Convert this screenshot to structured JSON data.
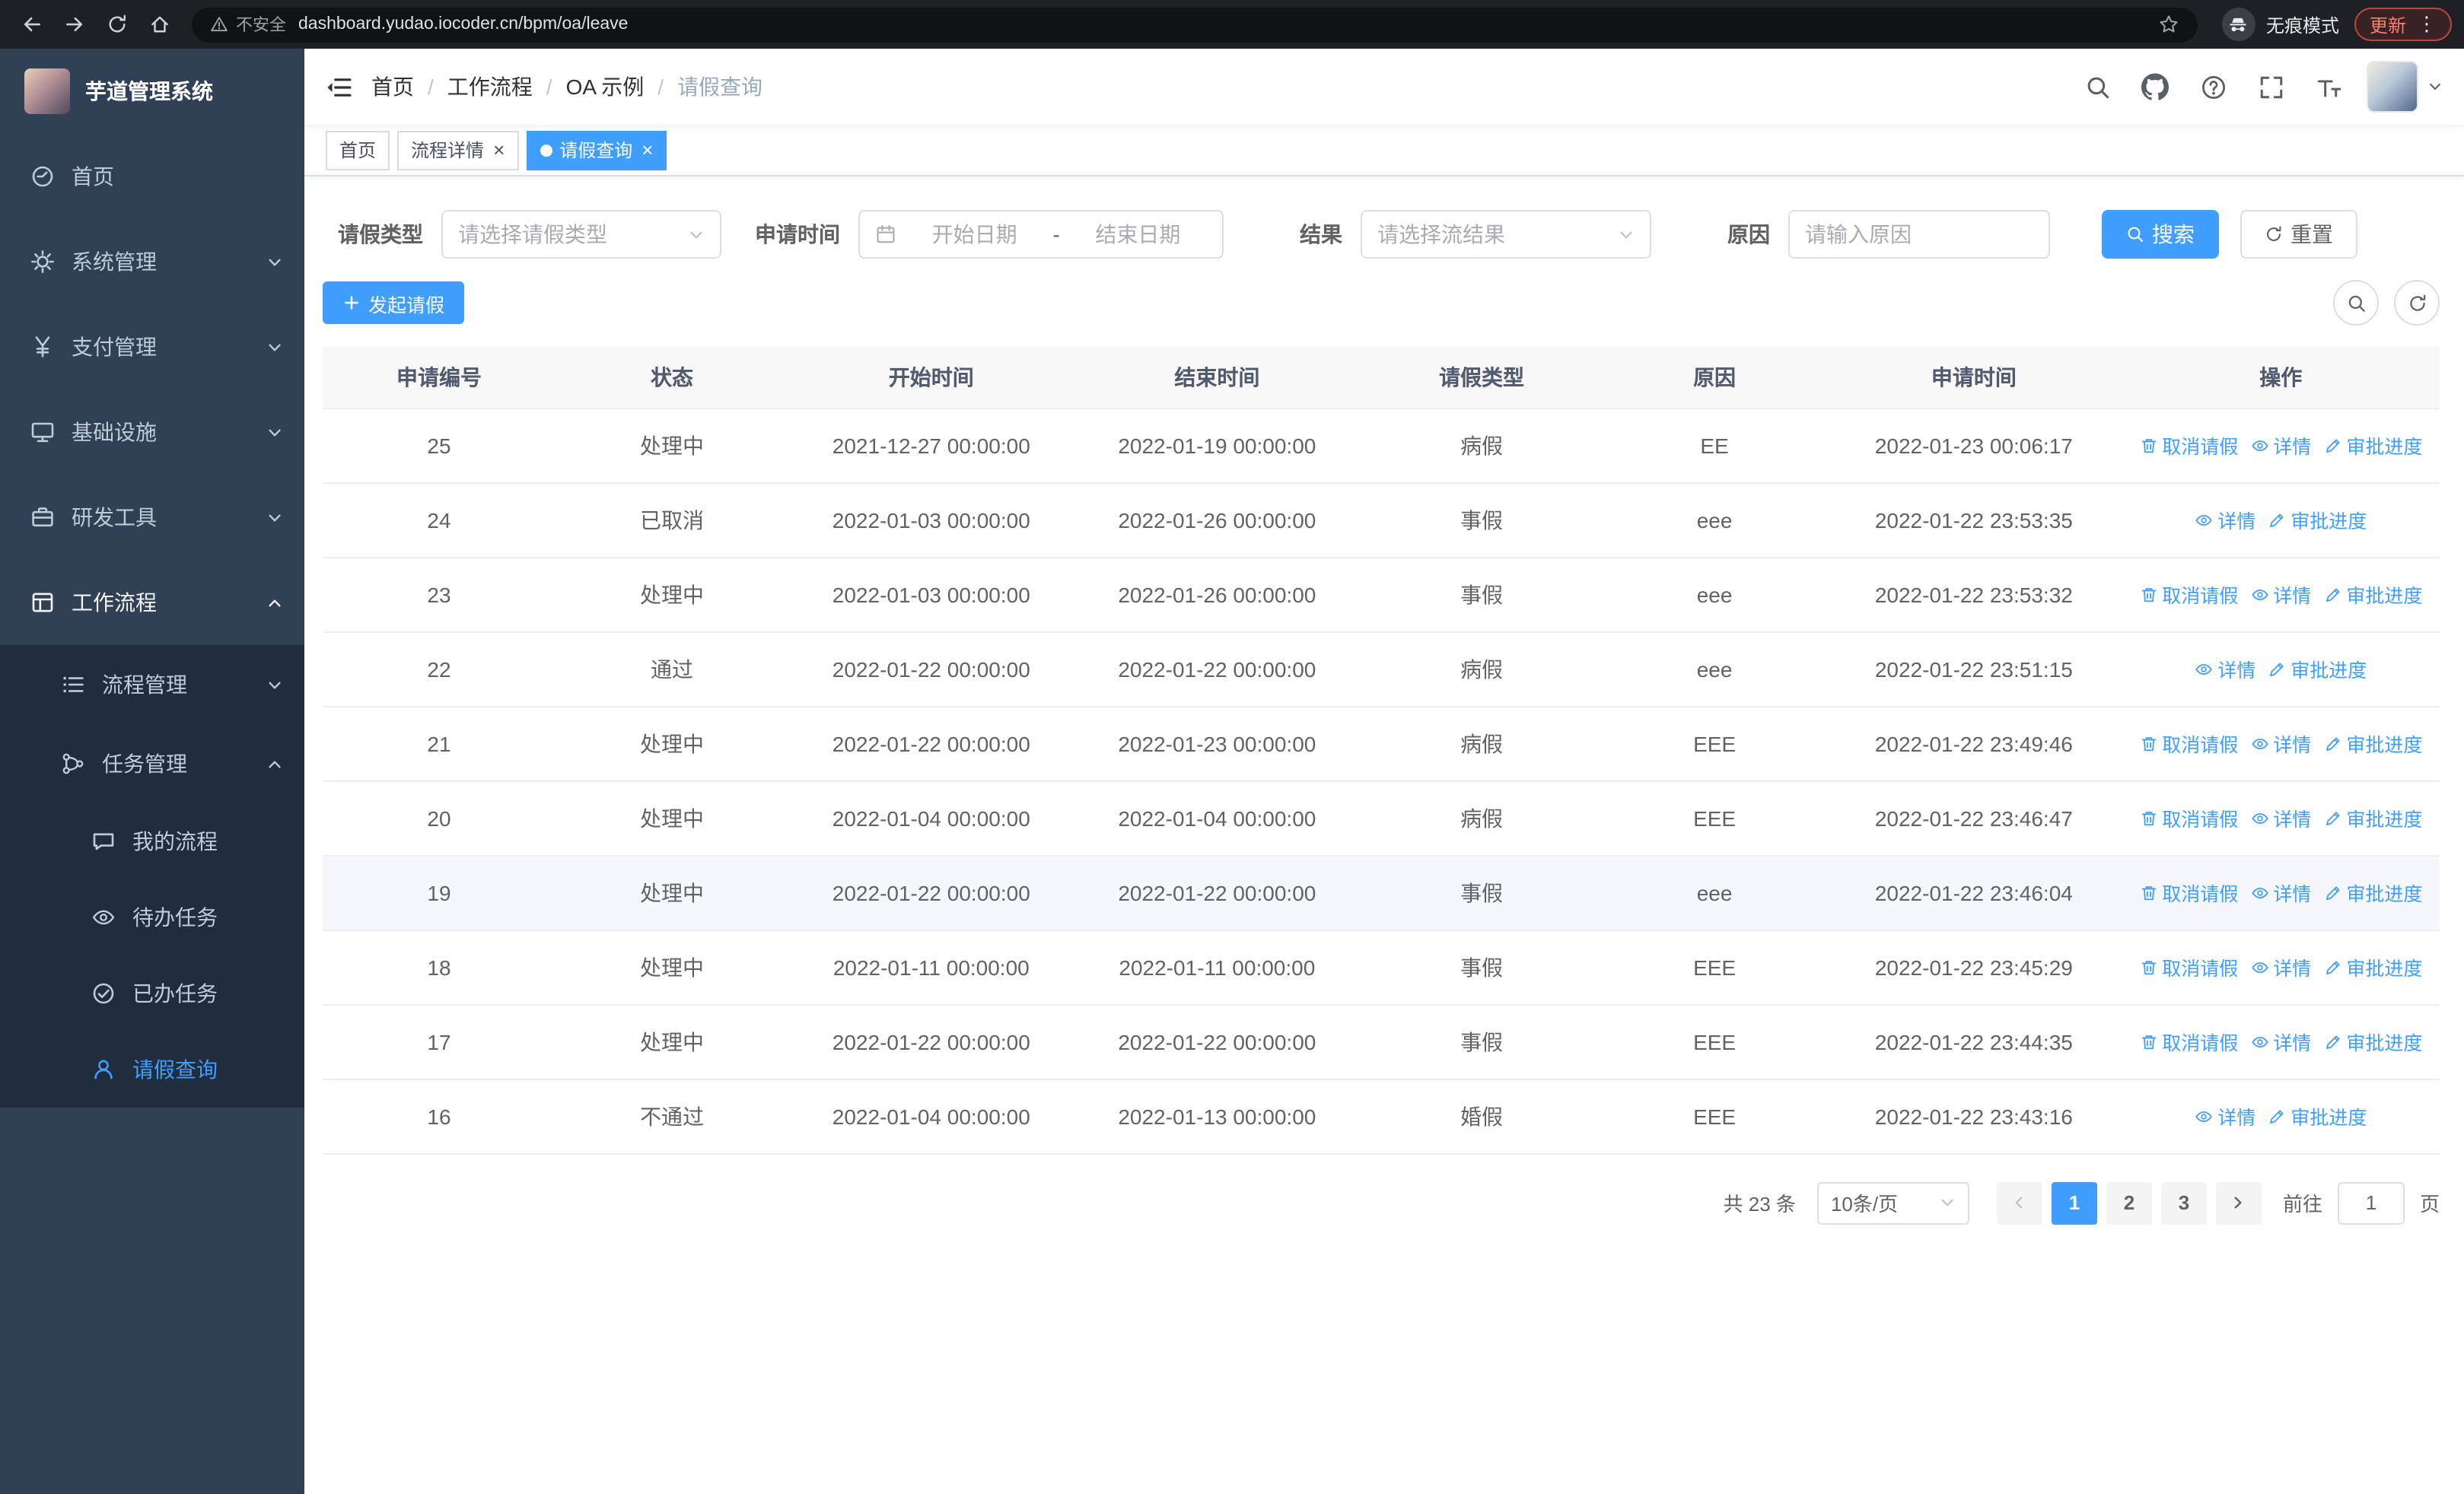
{
  "browser": {
    "warning": "不安全",
    "url": "dashboard.yudao.iocoder.cn/bpm/oa/leave",
    "incognito": "无痕模式",
    "update": "更新"
  },
  "icons": {
    "close": "×",
    "kebab": "⋮"
  },
  "sidebar": {
    "title": "芋道管理系统",
    "menu": [
      {
        "label": "首页"
      },
      {
        "label": "系统管理"
      },
      {
        "label": "支付管理"
      },
      {
        "label": "基础设施"
      },
      {
        "label": "研发工具"
      },
      {
        "label": "工作流程"
      }
    ],
    "submenu": [
      {
        "label": "流程管理"
      },
      {
        "label": "任务管理"
      }
    ],
    "leaves": [
      {
        "label": "我的流程"
      },
      {
        "label": "待办任务"
      },
      {
        "label": "已办任务"
      },
      {
        "label": "请假查询"
      }
    ]
  },
  "breadcrumb": {
    "separator": "/",
    "items": [
      "首页",
      "工作流程",
      "OA 示例",
      "请假查询"
    ]
  },
  "tabs": [
    {
      "label": "首页"
    },
    {
      "label": "流程详情"
    },
    {
      "label": "请假查询"
    }
  ],
  "filters": {
    "leave_type_label": "请假类型",
    "leave_type_placeholder": "请选择请假类型",
    "apply_time_label": "申请时间",
    "start_date_placeholder": "开始日期",
    "range_separator": "-",
    "end_date_placeholder": "结束日期",
    "result_label": "结果",
    "result_placeholder": "请选择流结果",
    "reason_label": "原因",
    "reason_placeholder": "请输入原因",
    "search": "搜索",
    "reset": "重置"
  },
  "toolbar": {
    "create": "发起请假"
  },
  "table": {
    "headers": [
      "申请编号",
      "状态",
      "开始时间",
      "结束时间",
      "请假类型",
      "原因",
      "申请时间",
      "操作"
    ],
    "actions": {
      "cancel": "取消请假",
      "detail": "详情",
      "progress": "审批进度"
    },
    "rows": [
      {
        "id": "25",
        "status": "处理中",
        "start": "2021-12-27 00:00:00",
        "end": "2022-01-19 00:00:00",
        "type": "病假",
        "reason": "EE",
        "applied": "2022-01-23 00:06:17"
      },
      {
        "id": "24",
        "status": "已取消",
        "start": "2022-01-03 00:00:00",
        "end": "2022-01-26 00:00:00",
        "type": "事假",
        "reason": "eee",
        "applied": "2022-01-22 23:53:35"
      },
      {
        "id": "23",
        "status": "处理中",
        "start": "2022-01-03 00:00:00",
        "end": "2022-01-26 00:00:00",
        "type": "事假",
        "reason": "eee",
        "applied": "2022-01-22 23:53:32"
      },
      {
        "id": "22",
        "status": "通过",
        "start": "2022-01-22 00:00:00",
        "end": "2022-01-22 00:00:00",
        "type": "病假",
        "reason": "eee",
        "applied": "2022-01-22 23:51:15"
      },
      {
        "id": "21",
        "status": "处理中",
        "start": "2022-01-22 00:00:00",
        "end": "2022-01-23 00:00:00",
        "type": "病假",
        "reason": "EEE",
        "applied": "2022-01-22 23:49:46"
      },
      {
        "id": "20",
        "status": "处理中",
        "start": "2022-01-04 00:00:00",
        "end": "2022-01-04 00:00:00",
        "type": "病假",
        "reason": "EEE",
        "applied": "2022-01-22 23:46:47"
      },
      {
        "id": "19",
        "status": "处理中",
        "start": "2022-01-22 00:00:00",
        "end": "2022-01-22 00:00:00",
        "type": "事假",
        "reason": "eee",
        "applied": "2022-01-22 23:46:04"
      },
      {
        "id": "18",
        "status": "处理中",
        "start": "2022-01-11 00:00:00",
        "end": "2022-01-11 00:00:00",
        "type": "事假",
        "reason": "EEE",
        "applied": "2022-01-22 23:45:29"
      },
      {
        "id": "17",
        "status": "处理中",
        "start": "2022-01-22 00:00:00",
        "end": "2022-01-22 00:00:00",
        "type": "事假",
        "reason": "EEE",
        "applied": "2022-01-22 23:44:35"
      },
      {
        "id": "16",
        "status": "不通过",
        "start": "2022-01-04 00:00:00",
        "end": "2022-01-13 00:00:00",
        "type": "婚假",
        "reason": "EEE",
        "applied": "2022-01-22 23:43:16"
      }
    ]
  },
  "pagination": {
    "total": "共 23 条",
    "page_size": "10条/页",
    "pages": [
      "1",
      "2",
      "3"
    ],
    "current": "1",
    "goto_label": "前往",
    "goto_value": "1",
    "page_unit": "页"
  },
  "colors": {
    "primary": "#409eff",
    "sidebar_bg": "#304156",
    "sidebar_sub_bg": "#1f2d3d",
    "chrome_bg": "#1f2023",
    "table_header_bg": "#f8f8f9",
    "update_chip": "#ff7b6e"
  }
}
